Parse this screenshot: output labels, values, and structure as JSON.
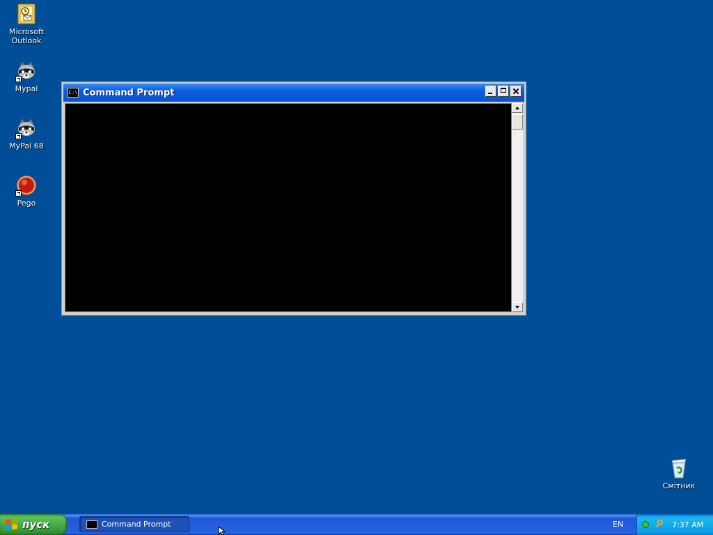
{
  "desktop": {
    "icons": [
      {
        "label": "Microsoft Outlook",
        "icon": "outlook-icon"
      },
      {
        "label": "Mypal",
        "icon": "mypal-raccoon-icon"
      },
      {
        "label": "MyPal 68",
        "icon": "mypal-raccoon-icon"
      },
      {
        "label": "Pego",
        "icon": "pego-icon"
      }
    ],
    "recycle_bin": {
      "label": "Смітник",
      "icon": "recycle-bin-icon"
    }
  },
  "window": {
    "title": "Command Prompt",
    "icon_text": "C:\\",
    "console_text": ""
  },
  "taskbar": {
    "start_label": "пуск",
    "tasks": [
      {
        "label": "Command Prompt"
      }
    ],
    "language": "EN",
    "clock": "7:37 AM"
  },
  "colors": {
    "desktop": "#004e98",
    "titlebar": "#0a5ee0",
    "taskbar": "#245edb",
    "start_button": "#3c9a3c",
    "tray": "#18b9f0"
  }
}
